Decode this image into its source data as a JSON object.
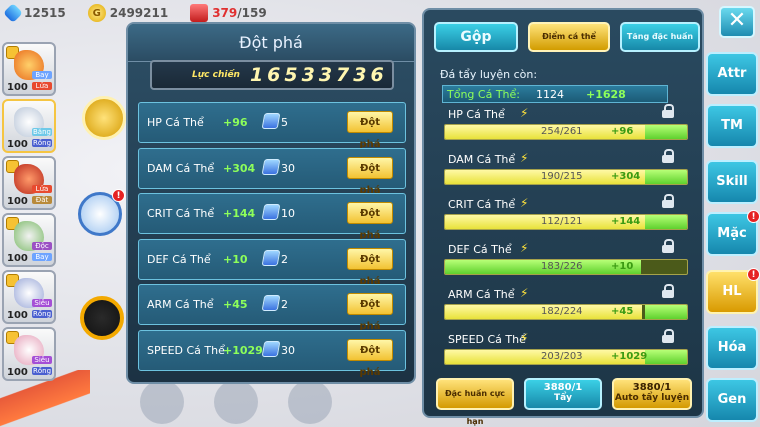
{
  "topbar": {
    "gems": "12515",
    "coins": "2499211",
    "energy_current": "379",
    "energy_max": "/159"
  },
  "pokemon_list": [
    {
      "level": "100",
      "tag1": "Bay",
      "tag2": "Lửa"
    },
    {
      "level": "100",
      "tag1": "Băng",
      "tag2": "Rồng"
    },
    {
      "level": "100",
      "tag1": "Lửa",
      "tag2": "Đất"
    },
    {
      "level": "100",
      "tag1": "Độc",
      "tag2": "Bay"
    },
    {
      "level": "100",
      "tag1": "Siêu",
      "tag2": "Rồng"
    },
    {
      "level": "100",
      "tag1": "Siêu",
      "tag2": "Rồng"
    }
  ],
  "left_panel": {
    "title": "Đột phá",
    "power_label": "Lực chiến",
    "power_value": "16533736",
    "button_label": "Đột phá",
    "rows": [
      {
        "stat": "HP Cá Thể",
        "plus": "+96",
        "count": "5"
      },
      {
        "stat": "DAM Cá Thể",
        "plus": "+304",
        "count": "30"
      },
      {
        "stat": "CRIT Cá Thể",
        "plus": "+144",
        "count": "10"
      },
      {
        "stat": "DEF Cá Thể",
        "plus": "+10",
        "count": "2"
      },
      {
        "stat": "ARM Cá Thể",
        "plus": "+45",
        "count": "2"
      },
      {
        "stat": "SPEED Cá Thể",
        "plus": "+1029",
        "count": "30"
      }
    ]
  },
  "right_panel": {
    "tabs": {
      "merge": "Gộp",
      "points": "Điểm cá thể",
      "special": "Tăng đặc huấn"
    },
    "remaining_label": "Đá tẩy luyện còn:",
    "total_label": "Tổng Cá Thể:",
    "total_value": "1124",
    "total_plus": "+1628",
    "stats": [
      {
        "name": "HP Cá Thể",
        "current": 254,
        "max": 261,
        "text": "254/261",
        "plus": "+96",
        "green": false
      },
      {
        "name": "DAM Cá Thể",
        "current": 190,
        "max": 215,
        "text": "190/215",
        "plus": "+304",
        "green": false
      },
      {
        "name": "CRIT Cá Thể",
        "current": 112,
        "max": 121,
        "text": "112/121",
        "plus": "+144",
        "green": false
      },
      {
        "name": "DEF Cá Thể",
        "current": 183,
        "max": 226,
        "text": "183/226",
        "plus": "+10",
        "green": true
      },
      {
        "name": "ARM Cá Thể",
        "current": 182,
        "max": 224,
        "text": "182/224",
        "plus": "+45",
        "green": false
      },
      {
        "name": "SPEED Cá Thể",
        "current": 203,
        "max": 203,
        "text": "203/203",
        "plus": "+1029",
        "green": false
      }
    ],
    "buttons": {
      "special_limit": "Đặc huấn cực hạn",
      "wash_count": "3880/1",
      "wash_label": "Tẩy",
      "auto_count": "3880/1",
      "auto_label": "Auto tẩy luyện"
    }
  },
  "side_tabs": [
    "Attr",
    "TM",
    "Skill",
    "Mặc",
    "HL",
    "Hóa",
    "Gen"
  ],
  "side_badge": "!",
  "close_label": "✕"
}
